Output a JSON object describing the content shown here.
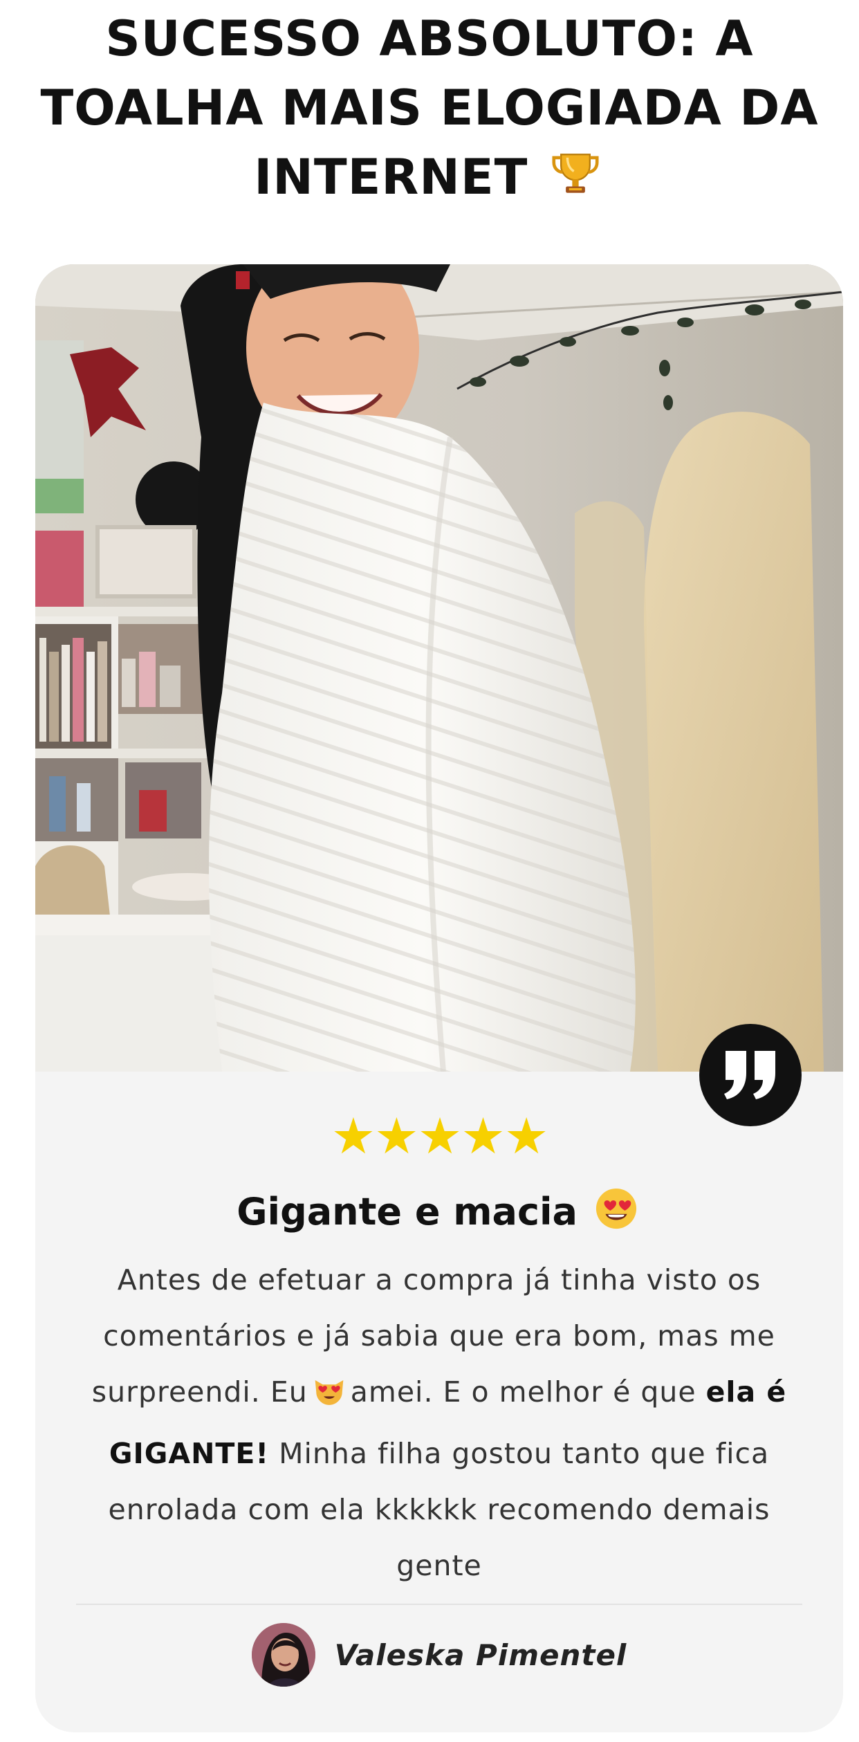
{
  "headline": {
    "text": "SUCESSO ABSOLUTO: A TOALHA MAIS ELOGIADA DA INTERNET",
    "emoji_icon": "trophy-icon"
  },
  "review": {
    "rating": 5,
    "rating_max": 5,
    "stars": "★★★★★",
    "star_color": "#f7d000",
    "title": "Gigante e macia",
    "title_emoji_icon": "heart-eyes-face-icon",
    "body_part1": "Antes de efetuar a compra já tinha visto os comentários e já sabia que era bom, mas me surpreendi. Eu",
    "body_emoji_icon": "heart-eyes-cat-icon",
    "body_part2": "amei. E o melhor é que",
    "body_bold": "ela é GIGANTE!",
    "body_part3": "Minha filha gostou tanto que fica enrolada com ela kkkkkk recomendo demais gente",
    "author": "Valeska Pimentel",
    "quote_icon": "quote-icon"
  },
  "colors": {
    "card_background": "#f4f4f4",
    "quote_badge": "#111111",
    "text_primary": "#111111"
  }
}
